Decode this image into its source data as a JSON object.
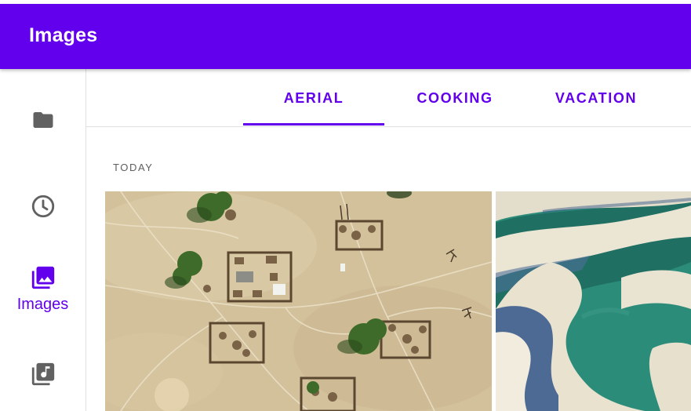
{
  "app_bar": {
    "title": "Images",
    "color": "#6200ee"
  },
  "nav_rail": {
    "items": [
      {
        "icon": "folder-icon",
        "label": "",
        "selected": false
      },
      {
        "icon": "clock-icon",
        "label": "",
        "selected": false
      },
      {
        "icon": "photo-library-icon",
        "label": "Images",
        "selected": true
      },
      {
        "icon": "music-library-icon",
        "label": "",
        "selected": false
      }
    ]
  },
  "tabs": [
    {
      "label": "AERIAL",
      "selected": true
    },
    {
      "label": "COOKING",
      "selected": false
    },
    {
      "label": "VACATION",
      "selected": false
    }
  ],
  "section": {
    "label": "TODAY"
  },
  "gallery": [
    {
      "icon": "aerial-village-photo"
    },
    {
      "icon": "aerial-dunes-lagoon-photo"
    }
  ]
}
